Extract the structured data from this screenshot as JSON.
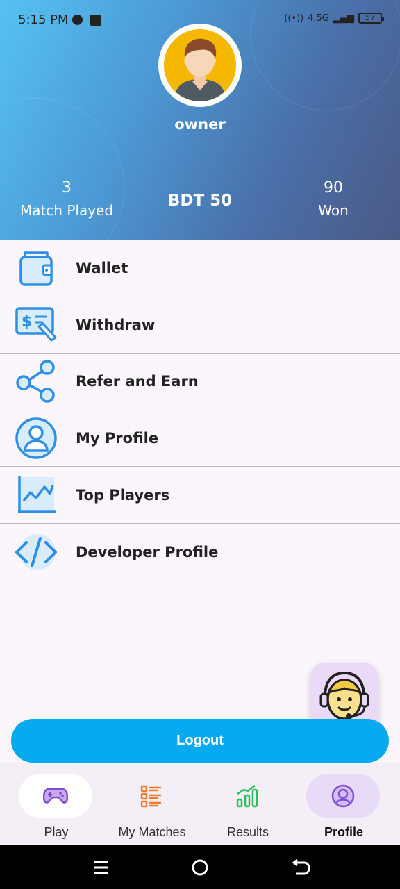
{
  "status_bar": {
    "time": "5:15 PM",
    "network": "4.5G",
    "battery": "57"
  },
  "profile": {
    "username": "owner",
    "matches_played_value": "3",
    "matches_played_label": "Match Played",
    "balance": "BDT 50",
    "won_value": "90",
    "won_label": "Won"
  },
  "menu": {
    "items": [
      {
        "label": "Wallet",
        "icon": "wallet-icon"
      },
      {
        "label": "Withdraw",
        "icon": "withdraw-icon"
      },
      {
        "label": "Refer and Earn",
        "icon": "share-icon"
      },
      {
        "label": "My Profile",
        "icon": "user-icon"
      },
      {
        "label": "Top Players",
        "icon": "chart-icon"
      },
      {
        "label": "Developer Profile",
        "icon": "code-icon"
      }
    ]
  },
  "logout_label": "Logout",
  "bottom_nav": {
    "items": [
      {
        "label": "Play",
        "icon": "gamepad-icon"
      },
      {
        "label": "My Matches",
        "icon": "list-icon"
      },
      {
        "label": "Results",
        "icon": "results-icon"
      },
      {
        "label": "Profile",
        "icon": "profile-icon"
      }
    ],
    "active": "Profile"
  },
  "colors": {
    "accent": "#07a9ef",
    "icon_blue": "#2f8fe6",
    "active_pill": "#e7dbf8",
    "play_pill": "#ffffff"
  }
}
